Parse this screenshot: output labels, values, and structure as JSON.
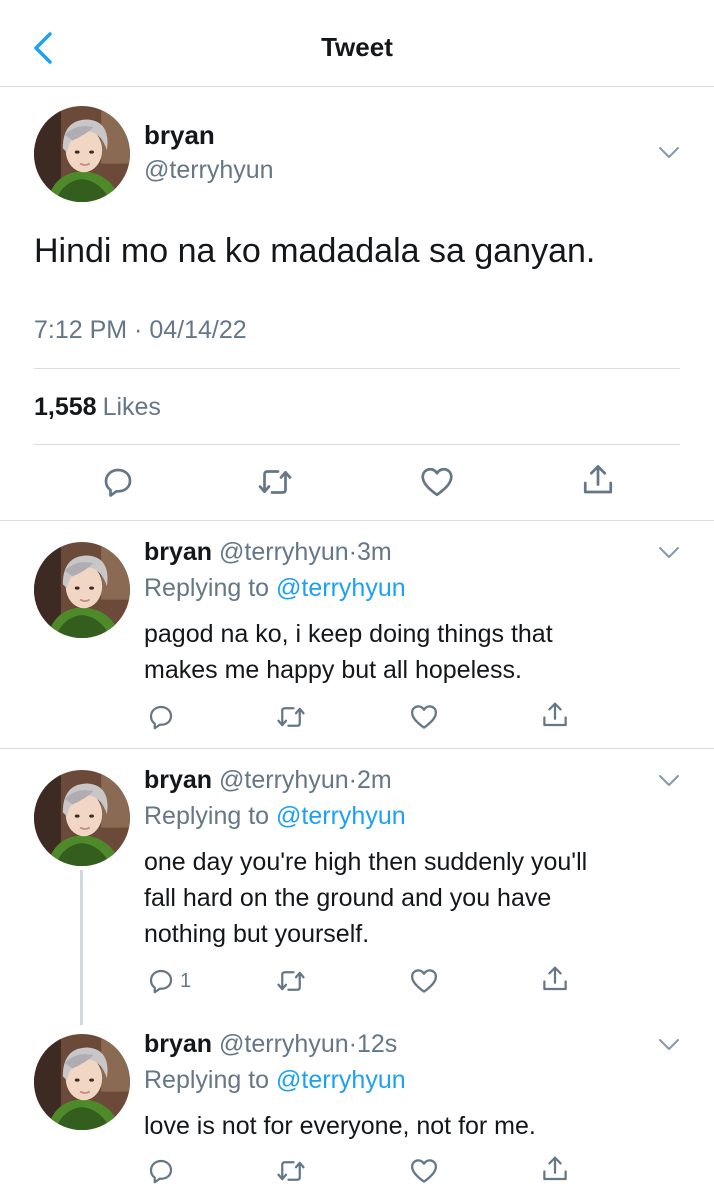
{
  "header": {
    "title": "Tweet",
    "back_icon": "chevron-left-icon",
    "accent": "#1da1f2"
  },
  "main_tweet": {
    "name": "bryan",
    "handle": "@terryhyun",
    "text": "Hindi mo na ko madadala sa ganyan.",
    "timestamp": "7:12 PM · 04/14/22",
    "likes_count": "1,558",
    "likes_label": "Likes",
    "actions": [
      "reply-icon",
      "retweet-icon",
      "like-icon",
      "share-icon"
    ]
  },
  "replies": [
    {
      "name": "bryan",
      "handle": "@terryhyun",
      "dot": "·",
      "time": "3m",
      "replying_prefix": "Replying to",
      "replying_to": "@terryhyun",
      "text_lines": [
        "pagod na ko, i keep doing things that",
        "makes me happy but all hopeless."
      ],
      "reply_count": ""
    },
    {
      "name": "bryan",
      "handle": "@terryhyun",
      "dot": "·",
      "time": "2m",
      "replying_prefix": "Replying to",
      "replying_to": "@terryhyun",
      "text_lines": [
        "one day you're high then suddenly you'll",
        "fall hard on the ground and you have",
        "nothing but yourself."
      ],
      "reply_count": "1"
    },
    {
      "name": "bryan",
      "handle": "@terryhyun",
      "dot": "·",
      "time": "12s",
      "replying_prefix": "Replying to",
      "replying_to": "@terryhyun",
      "text_lines": [
        "love is not for everyone, not for me."
      ],
      "reply_count": ""
    }
  ],
  "colors": {
    "text": "#14171a",
    "muted": "#657786",
    "link": "#1da1f2",
    "divider": "#dcdcdc"
  }
}
